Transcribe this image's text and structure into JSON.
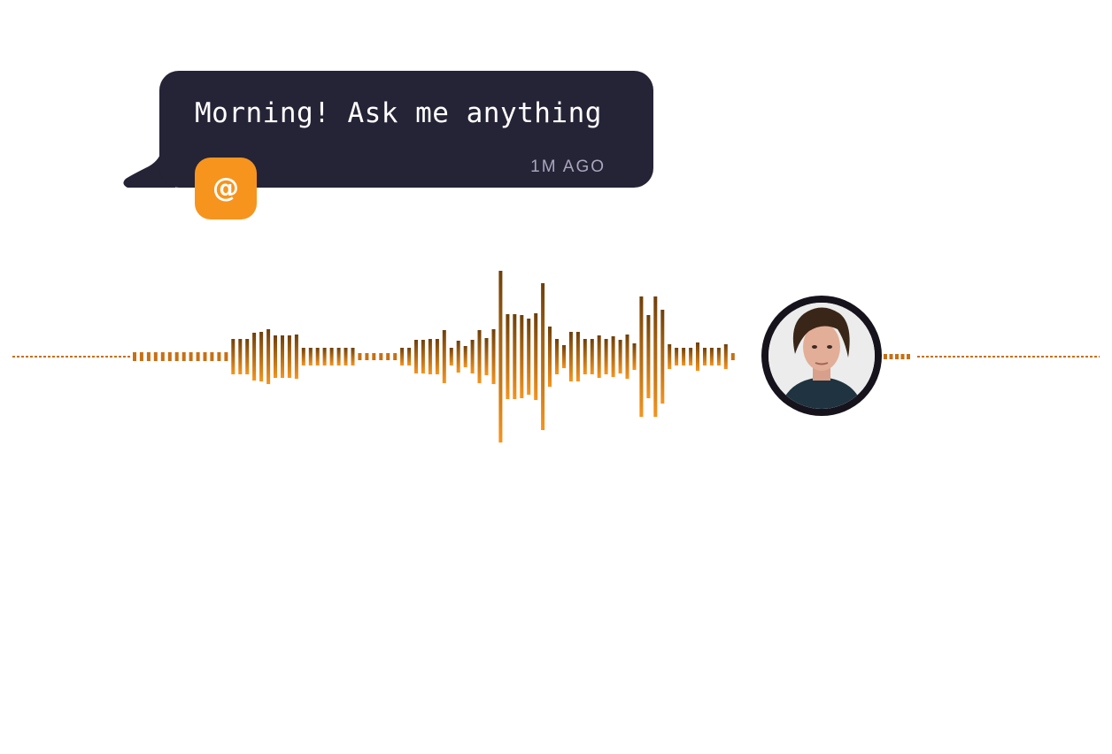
{
  "message": {
    "text": "Morning! Ask me anything",
    "time": "1M AGO"
  },
  "app_badge": {
    "glyph": "@",
    "icon": "at-sign-icon",
    "color": "#f7941d"
  },
  "bubble": {
    "color": "#252336"
  },
  "waveform": {
    "color_top": "#6e3f0a",
    "color_bottom": "#f7941d",
    "levels": [
      5,
      5,
      5,
      5,
      5,
      5,
      5,
      5,
      5,
      5,
      5,
      5,
      5,
      5,
      20,
      20,
      20,
      27,
      28,
      31,
      24,
      24,
      24,
      25,
      10,
      10,
      10,
      10,
      10,
      10,
      10,
      10,
      4,
      4,
      4,
      4,
      4,
      4,
      10,
      10,
      19,
      19,
      20,
      20,
      30,
      10,
      18,
      12,
      19,
      30,
      21,
      31,
      97,
      48,
      48,
      47,
      43,
      49,
      83,
      34,
      20,
      13,
      28,
      28,
      20,
      20,
      24,
      20,
      23,
      19,
      25,
      15,
      68,
      47,
      68,
      53,
      14,
      10,
      10,
      10,
      16,
      10,
      10,
      10,
      14,
      4
    ],
    "right_stub": [
      3,
      3,
      3,
      3,
      3
    ]
  },
  "avatar": {
    "icon": "user-avatar-icon",
    "ring_color": "#17131d"
  }
}
